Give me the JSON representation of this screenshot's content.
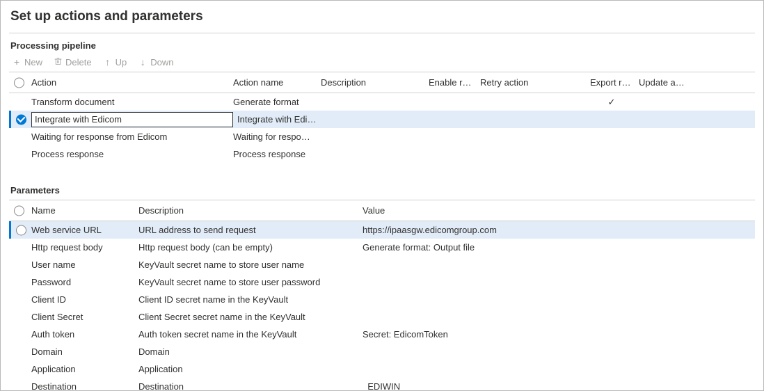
{
  "page": {
    "title": "Set up actions and parameters"
  },
  "sections": {
    "pipeline": "Processing pipeline",
    "parameters": "Parameters"
  },
  "toolbar": {
    "new": "New",
    "delete": "Delete",
    "up": "Up",
    "down": "Down"
  },
  "actions": {
    "columns": {
      "action": "Action",
      "action_name": "Action name",
      "description": "Description",
      "enable_retry": "Enable retry",
      "retry_action": "Retry action",
      "export_result": "Export result",
      "update_action": "Update act..."
    },
    "rows": [
      {
        "selected": false,
        "action": "Transform document",
        "action_name": "Generate format",
        "description": "",
        "enable_retry": "",
        "retry_action": "",
        "export_result": "✓",
        "update_action": ""
      },
      {
        "selected": true,
        "action": "Integrate with Edicom",
        "action_name": "Integrate with Edicom",
        "description": "",
        "enable_retry": "",
        "retry_action": "",
        "export_result": "",
        "update_action": ""
      },
      {
        "selected": false,
        "action": "Waiting for response from Edicom",
        "action_name": "Waiting for response fro...",
        "description": "",
        "enable_retry": "",
        "retry_action": "",
        "export_result": "",
        "update_action": ""
      },
      {
        "selected": false,
        "action": "Process response",
        "action_name": "Process response",
        "description": "",
        "enable_retry": "",
        "retry_action": "",
        "export_result": "",
        "update_action": ""
      }
    ]
  },
  "parameters": {
    "columns": {
      "name": "Name",
      "description": "Description",
      "value": "Value"
    },
    "rows": [
      {
        "selected": true,
        "name": "Web service URL",
        "description": "URL address to send request",
        "value": "https://ipaasgw.edicomgroup.com"
      },
      {
        "selected": false,
        "name": "Http request body",
        "description": "Http request body (can be empty)",
        "value": "Generate format: Output file"
      },
      {
        "selected": false,
        "name": "User name",
        "description": "KeyVault secret name to store user name",
        "value": ""
      },
      {
        "selected": false,
        "name": "Password",
        "description": "KeyVault secret name to store user password",
        "value": ""
      },
      {
        "selected": false,
        "name": "Client ID",
        "description": "Client ID secret name in the KeyVault",
        "value": ""
      },
      {
        "selected": false,
        "name": "Client Secret",
        "description": "Client Secret secret name in the KeyVault",
        "value": ""
      },
      {
        "selected": false,
        "name": "Auth token",
        "description": "Auth token secret name in the KeyVault",
        "value": "Secret:  EdicomToken"
      },
      {
        "selected": false,
        "name": "Domain",
        "description": "Domain",
        "value": ""
      },
      {
        "selected": false,
        "name": "Application",
        "description": "Application",
        "value": ""
      },
      {
        "selected": false,
        "name": "Destination",
        "description": "Destination",
        "value": "_EDIWIN"
      }
    ]
  }
}
